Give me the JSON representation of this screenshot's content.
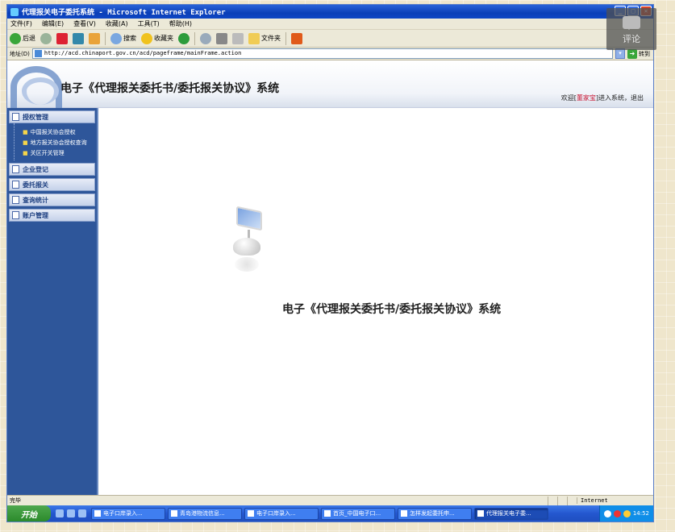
{
  "window": {
    "title": "代理报关电子委托系统 - Microsoft Internet Explorer"
  },
  "menubar": {
    "items": [
      "文件(F)",
      "编辑(E)",
      "查看(V)",
      "收藏(A)",
      "工具(T)",
      "帮助(H)"
    ]
  },
  "toolbar": {
    "back_label": "后退",
    "search_label": "搜索",
    "favorites_label": "收藏夹",
    "folders_label": "文件夹"
  },
  "addressbar": {
    "label": "地址(D)",
    "url": "http://acd.chinaport.gov.cn/acd/pageframe/mainFrame.action",
    "go_label": "转到"
  },
  "app": {
    "title": "电子《代理报关委托书/委托报关协议》系统",
    "welcome_prefix": "欢迎[",
    "username": "董家宝",
    "welcome_suffix": "]进入系统，退出"
  },
  "sidebar": {
    "sections": [
      {
        "label": "授权管理",
        "items": [
          "中国报关协会授权",
          "地方报关协会授权查询",
          "关区开关管理"
        ]
      },
      {
        "label": "企业登记",
        "items": []
      },
      {
        "label": "委托报关",
        "items": []
      },
      {
        "label": "查询统计",
        "items": []
      },
      {
        "label": "账户管理",
        "items": []
      }
    ]
  },
  "main": {
    "center_title": "电子《代理报关委托书/委托报关协议》系统"
  },
  "statusbar": {
    "text": "完毕",
    "zone": "Internet"
  },
  "taskbar": {
    "start_label": "开始",
    "tasks": [
      {
        "label": "电子口岸录入...",
        "active": false
      },
      {
        "label": "青岛港物流信息...",
        "active": false
      },
      {
        "label": "电子口岸录入...",
        "active": false
      },
      {
        "label": "首页_中国电子口...",
        "active": false
      },
      {
        "label": "怎样发起委托申...",
        "active": false
      },
      {
        "label": "代理报关电子委...",
        "active": true
      }
    ],
    "clock": "14:52"
  },
  "overlay": {
    "comment_label": "评论"
  }
}
